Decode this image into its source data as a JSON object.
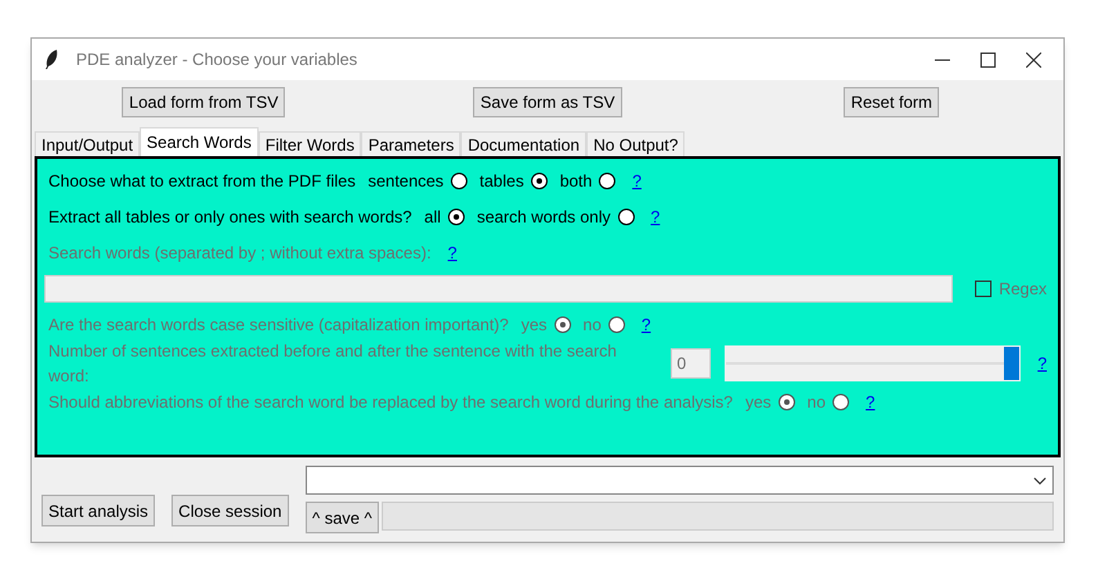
{
  "window": {
    "title": "PDE analyzer - Choose your variables"
  },
  "toolbar": [
    "Load form from TSV",
    "Save form as TSV",
    "Reset form"
  ],
  "tabs": [
    {
      "label": "Input/Output",
      "selected": false
    },
    {
      "label": "Search Words",
      "selected": true
    },
    {
      "label": "Filter Words",
      "selected": false
    },
    {
      "label": "Parameters",
      "selected": false
    },
    {
      "label": "Documentation",
      "selected": false
    },
    {
      "label": "No Output?",
      "selected": false
    }
  ],
  "rows": [
    {
      "kind": "radio",
      "label": "Choose what to extract from the PDF files",
      "disabled": false,
      "options": [
        {
          "label": "sentences",
          "selected": false
        },
        {
          "label": "tables",
          "selected": true
        },
        {
          "label": "both",
          "selected": false
        }
      ],
      "help": "?"
    },
    {
      "kind": "radio",
      "label": "Extract all tables or only ones with search words?",
      "disabled": false,
      "options": [
        {
          "label": "all",
          "selected": true
        },
        {
          "label": "search words only",
          "selected": false
        }
      ],
      "help": "?"
    },
    {
      "kind": "label",
      "label": "Search words (separated by ; without extra spaces):",
      "disabled": true,
      "help": "?"
    },
    {
      "kind": "field",
      "disabled": true,
      "checkbox": {
        "label": "Regex",
        "checked": false
      }
    },
    {
      "kind": "radio",
      "label": "Are the search words case sensitive (capitalization important)?",
      "disabled": true,
      "options": [
        {
          "label": "yes",
          "selected": true
        },
        {
          "label": "no",
          "selected": false
        }
      ],
      "help": "?"
    },
    {
      "kind": "slider",
      "label": "Number of sentences extracted before and after the sentence with the search word:",
      "disabled": true,
      "value": "0",
      "level": 1,
      "help": "?"
    },
    {
      "kind": "radio",
      "label": "Should abbreviations of the search word be replaced by the search word during the analysis?",
      "disabled": true,
      "options": [
        {
          "label": "yes",
          "selected": true
        },
        {
          "label": "no",
          "selected": false
        }
      ],
      "help": "?"
    }
  ],
  "bottom": {
    "buttons": [
      "Start analysis",
      "Close session"
    ],
    "save_button": "^ save ^"
  }
}
